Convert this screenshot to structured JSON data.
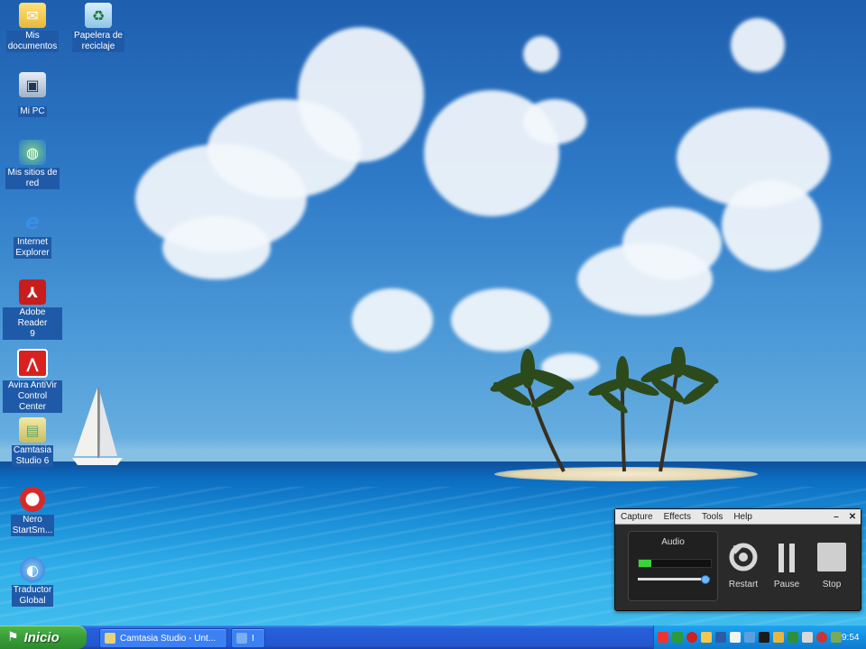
{
  "desktop": {
    "icons": [
      {
        "label": "Mis\ndocumentos",
        "icon": "my-documents-icon"
      },
      {
        "label": "Papelera de\nreciclaje",
        "icon": "recycle-bin-icon"
      },
      {
        "label": "Mi PC",
        "icon": "my-computer-icon"
      },
      {
        "label": "Mis sitios de\nred",
        "icon": "network-places-icon"
      },
      {
        "label": "Internet\nExplorer",
        "icon": "internet-explorer-icon"
      },
      {
        "label": "Adobe Reader\n9",
        "icon": "adobe-reader-icon"
      },
      {
        "label": "Avira AntiVir\nControl Center",
        "icon": "avira-icon"
      },
      {
        "label": "Camtasia\nStudio 6",
        "icon": "camtasia-icon"
      },
      {
        "label": "Nero\nStartSm...",
        "icon": "nero-icon"
      },
      {
        "label": "Traductor\nGlobal",
        "icon": "translator-icon"
      }
    ]
  },
  "recorder": {
    "menu": [
      "Capture",
      "Effects",
      "Tools",
      "Help"
    ],
    "window_buttons": [
      "–",
      "✕"
    ],
    "audio_label": "Audio",
    "audio_level": 0.18,
    "volume_level": 0.92,
    "restart_label": "Restart",
    "pause_label": "Pause",
    "stop_label": "Stop"
  },
  "taskbar": {
    "start_label": "Inicio",
    "tasks": [
      {
        "label": "Camtasia Studio - Unt..."
      },
      {
        "label": "I"
      }
    ],
    "clock": "9:54"
  },
  "colors": {
    "taskbar_blue": "#2457d0",
    "start_green": "#3a9e3a",
    "tray_blue": "#138ee1",
    "label_blue": "#1f5aa8"
  }
}
